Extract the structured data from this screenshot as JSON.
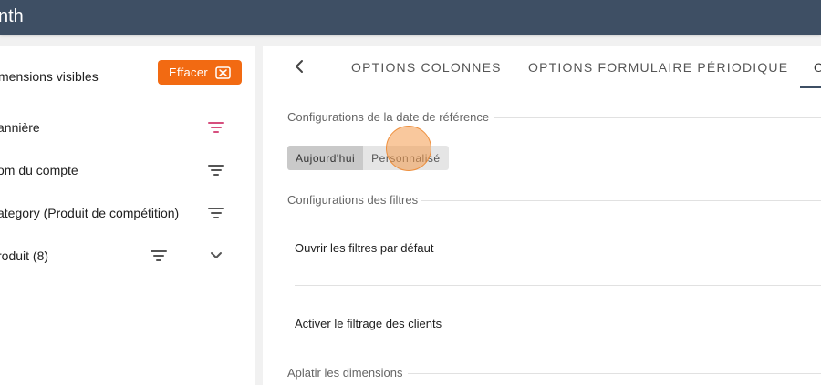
{
  "app": {
    "title": "nth"
  },
  "left_panel": {
    "header_label": "mensions visibles",
    "clear_button_label": "Effacer",
    "dimensions": [
      {
        "label": "annière",
        "filter_active": true
      },
      {
        "label": "om du compte",
        "filter_active": false
      },
      {
        "label": "ategory (Produit de compétition)",
        "filter_active": false
      },
      {
        "label": "roduit (8)",
        "filter_active": false,
        "expandable": true
      }
    ]
  },
  "right_panel": {
    "tabs": [
      {
        "label": "OPTIONS COLONNES"
      },
      {
        "label": "OPTIONS FORMULAIRE PÉRIODIQUE"
      },
      {
        "label": "O"
      }
    ],
    "sections": {
      "reference_date": {
        "title": "Configurations de la date de référence",
        "options": [
          "Aujourd'hui",
          "Personnalisé"
        ],
        "selected": "Aujourd'hui"
      },
      "filters": {
        "title": "Configurations des filtres",
        "rows": [
          "Ouvrir les filtres par défaut",
          "Activer le filtrage des clients"
        ]
      },
      "flatten": {
        "title": "Aplatir les dimensions"
      }
    }
  },
  "colors": {
    "topbar": "#3e4f64",
    "accent_orange": "#f26a12",
    "active_filter": "#d64f7e",
    "click_indicator": "#f49b4c"
  }
}
